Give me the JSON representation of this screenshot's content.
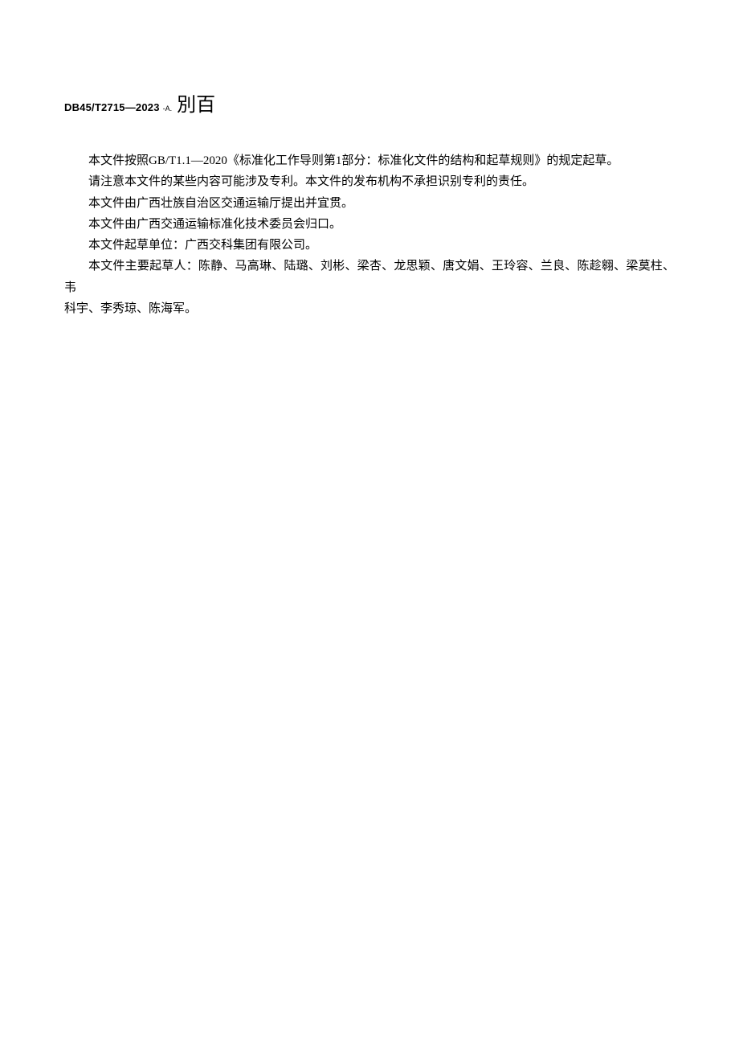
{
  "header": {
    "std_code": "DB45/T2715—2023",
    "std_small": "-A.",
    "title_chars": "別百"
  },
  "paragraphs": {
    "p1": "本文件按照GB/T1.1—2020《标准化工作导则第1部分：标准化文件的结构和起草规则》的规定起草。",
    "p2": "请注意本文件的某些内容可能涉及专利。本文件的发布机构不承担识别专利的责任。",
    "p3": "本文件由广西壮族自治区交通运输厅提出并宜贯。",
    "p4": "本文件由广西交通运输标准化技术委员会归口。",
    "p5": "本文件起草单位：广西交科集团有限公司。",
    "p6a": "本文件主要起草人：陈静、马高琳、陆璐、刘彬、梁杏、龙思颖、唐文娟、王玲容、兰良、陈趁翱、梁莫柱、韦",
    "p6b": "科宇、李秀琼、陈海军。"
  }
}
